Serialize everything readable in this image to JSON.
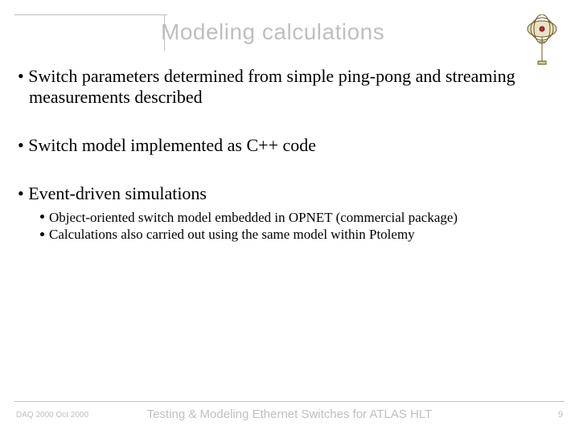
{
  "title": "Modeling calculations",
  "bullets": {
    "b1": "Switch parameters determined from simple ping-pong and streaming measurements described",
    "b2": "Switch model implemented as C++ code",
    "b3": "Event-driven simulations",
    "b3_subs": {
      "s1": "Object-oriented switch model embedded in OPNET (commercial package)",
      "s2": "Calculations also carried out using the same model within Ptolemy"
    }
  },
  "footer": {
    "left": "DAQ 2000 Oct 2000",
    "center": "Testing & Modeling Ethernet Switches for ATLAS HLT",
    "page": "9"
  },
  "logo_name": "atlas-detector-icon"
}
